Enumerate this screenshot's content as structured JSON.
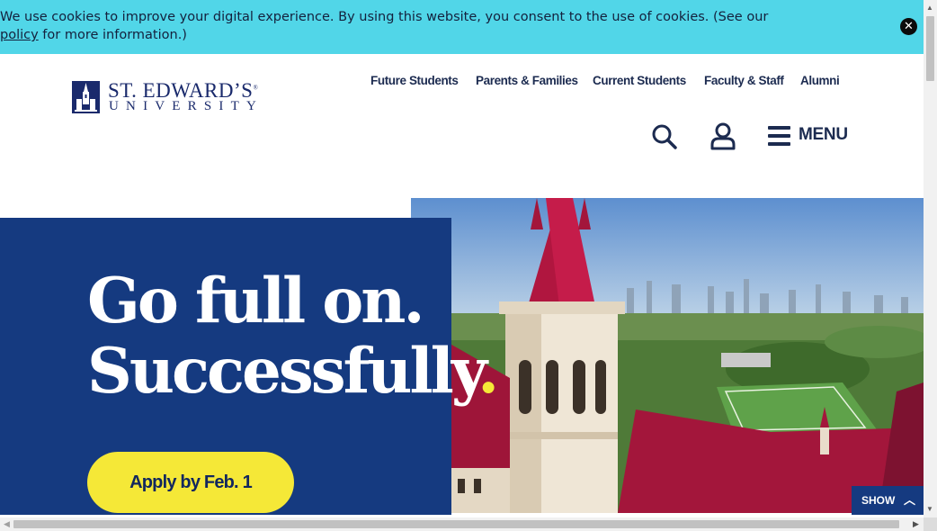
{
  "cookie_banner": {
    "text_before": "We use cookies to improve your digital experience. By using this website, you consent to the use of cookies. (See our ",
    "link": "policy",
    "text_after": " for more information.)",
    "close_icon": "close-circle-icon"
  },
  "logo": {
    "name": "ST. EDWARD’S",
    "trademark": "®",
    "subtitle": "UNIVERSITY"
  },
  "top_nav": [
    "Future Students",
    "Parents & Families",
    "Current Students",
    "Faculty & Staff",
    "Alumni"
  ],
  "tools": {
    "search_icon": "search-icon",
    "account_icon": "user-icon",
    "menu_icon": "hamburger-icon",
    "menu_label": "MENU"
  },
  "hero": {
    "line1": "Go full on.",
    "line2": "Successfully",
    "line2_dot": ".",
    "cta": "Apply by Feb. 1",
    "image": "aerial-campus-tower-photo"
  },
  "show_toggle": {
    "label": "SHOW",
    "icon": "chevron-up-icon"
  },
  "colors": {
    "cookie_bg": "#51d6e8",
    "brand_blue": "#153a80",
    "accent_yellow": "#f5e837",
    "nav_text": "#1c2b50"
  }
}
